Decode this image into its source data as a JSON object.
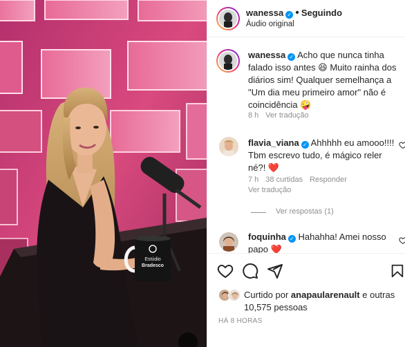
{
  "header": {
    "username": "wanessa",
    "follow_status": "Seguindo",
    "audio": "Áudio original",
    "separator": "•"
  },
  "caption": {
    "username": "wanessa",
    "text": "Acho que nunca tinha falado isso antes 😆 Muito rainha dos diários sim! Qualquer semelhança a \"Um dia meu primeiro amor\" não é coincidência 🤪",
    "time": "8 h",
    "translate": "Ver tradução"
  },
  "comments": [
    {
      "username": "flavia_viana",
      "text": "Ahhhhh eu amooo!!!! Tbm escrevo tudo, é mágico reler né?! ❤️",
      "time": "7 h",
      "likes": "38 curtidas",
      "reply": "Responder",
      "translate": "Ver tradução",
      "view_replies": "Ver respostas (1)"
    },
    {
      "username": "foquinha",
      "text": "Hahahha! Amei nosso papo ❤️"
    }
  ],
  "likes": {
    "text_prefix": "Curtido por ",
    "liker": "anapaularenault",
    "text_middle": " e ",
    "others": "outras 10,575 pessoas"
  },
  "posted": "HÁ 8 HORAS",
  "video_overlay": {
    "mug_text_top": "Estúdio",
    "mug_text_bottom": "Bradesco"
  },
  "colors": {
    "verified": "#0095f6",
    "heart": "#ed4956",
    "secondary_text": "#8e8e8e",
    "studio_pink": "#c93a73"
  }
}
